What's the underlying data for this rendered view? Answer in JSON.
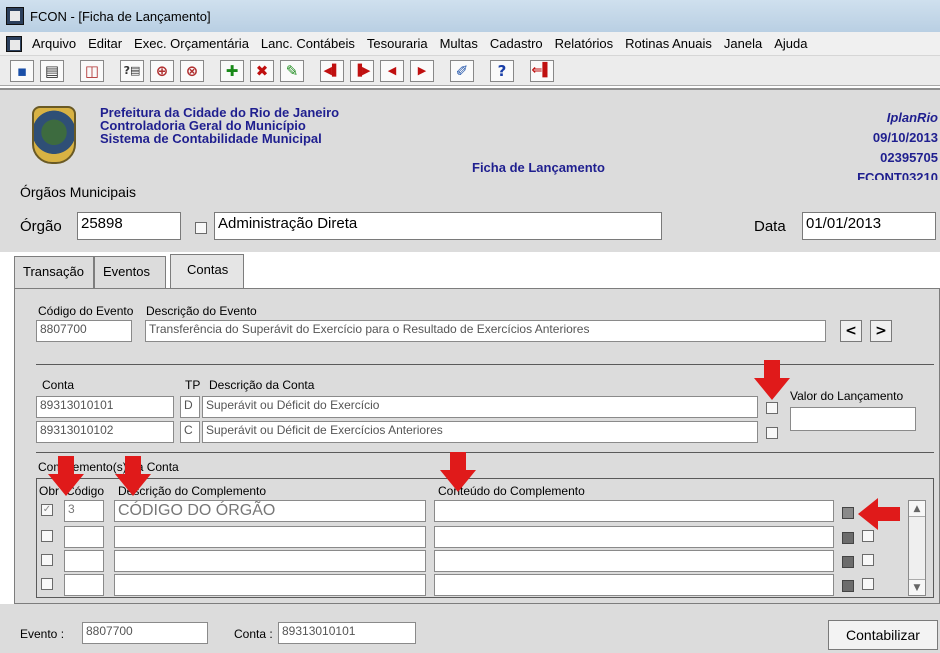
{
  "window": {
    "title": "FCON - [Ficha de Lançamento]"
  },
  "menu": [
    "Arquivo",
    "Editar",
    "Exec. Orçamentária",
    "Lanc. Contábeis",
    "Tesouraria",
    "Multas",
    "Cadastro",
    "Relatórios",
    "Rotinas Anuais",
    "Janela",
    "Ajuda"
  ],
  "header": {
    "org_line1": "Prefeitura da Cidade do Rio de Janeiro",
    "org_line2": "Controladoria Geral do Município",
    "org_line3": "Sistema de Contabilidade Municipal",
    "screen_title": "Ficha de Lançamento",
    "brand": "IplanRio",
    "date": "09/10/2013",
    "code": "02395705",
    "form_id": "FCONT03210"
  },
  "orgaos": {
    "section_label": "Órgãos Municipais",
    "orgao_label": "Órgão",
    "orgao_value": "25898",
    "orgao_desc": "Administração Direta",
    "data_label": "Data",
    "data_value": "01/01/2013"
  },
  "tabs": [
    "Transação",
    "Eventos",
    "Contas"
  ],
  "evento": {
    "codigo_label": "Código do Evento",
    "desc_label": "Descrição do Evento",
    "codigo": "8807700",
    "descricao": "Transferência do Superávit do Exercício para o Resultado de Exercícios Anteriores",
    "prev": "<",
    "next": ">"
  },
  "contas": {
    "conta_label": "Conta",
    "tp_label": "TP",
    "desc_label": "Descrição da Conta",
    "valor_label": "Valor do Lançamento",
    "rows": [
      {
        "conta": "89313010101",
        "tp": "D",
        "descricao": "Superávit ou Déficit do Exercício"
      },
      {
        "conta": "89313010102",
        "tp": "C",
        "descricao": "Superávit ou Déficit de Exercícios Anteriores"
      }
    ]
  },
  "complementos": {
    "section_label": "Complemento(s) da Conta",
    "obr_label": "Obr",
    "codigo_label": "Código",
    "desc_label": "Descrição do Complemento",
    "conteudo_label": "Conteúdo do Complemento",
    "rows": [
      {
        "obr": true,
        "codigo": "3",
        "descricao": "CÓDIGO DO ÓRGÃO",
        "conteudo": ""
      },
      {
        "obr": false,
        "codigo": "",
        "descricao": "",
        "conteudo": ""
      },
      {
        "obr": false,
        "codigo": "",
        "descricao": "",
        "conteudo": ""
      },
      {
        "obr": false,
        "codigo": "",
        "descricao": "",
        "conteudo": ""
      }
    ]
  },
  "footer": {
    "evento_label": "Evento :",
    "evento_value": "8807700",
    "conta_label": "Conta :",
    "conta_value": "89313010101",
    "contabilizar": "Contabilizar"
  },
  "colors": {
    "header_text": "#1f1f8f",
    "annotation_arrow": "#e01a1a",
    "panel_bg": "#dcdcdc"
  }
}
